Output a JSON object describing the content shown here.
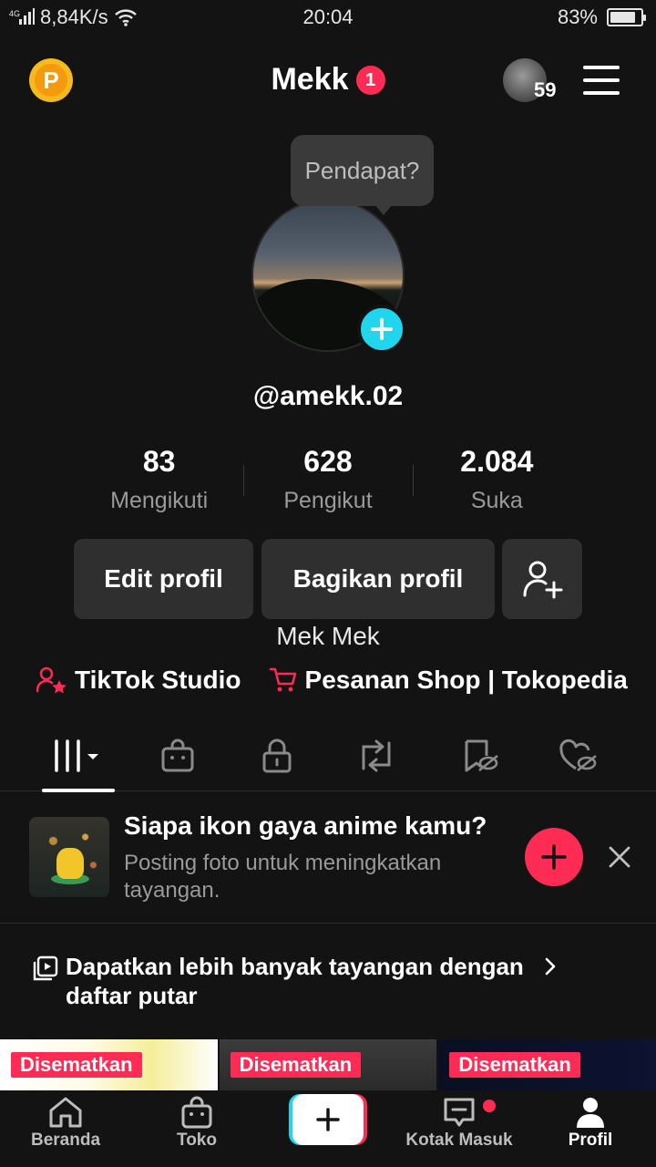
{
  "status_bar": {
    "network": "4G",
    "speed": "8,84K/s",
    "time": "20:04",
    "battery": "83%",
    "battery_level": 0.83
  },
  "header": {
    "title": "Mekk",
    "notification_count": "1",
    "account_count": "59"
  },
  "profile": {
    "tooltip": "Pendapat?",
    "username": "@amekk.02",
    "stats": [
      {
        "value": "83",
        "label": "Mengikuti"
      },
      {
        "value": "628",
        "label": "Pengikut"
      },
      {
        "value": "2.084",
        "label": "Suka"
      }
    ],
    "edit_label": "Edit profil",
    "share_label": "Bagikan profil",
    "bio": "Mek Mek",
    "links": {
      "studio": "TikTok Studio",
      "shop": "Pesanan Shop | Tokopedia"
    }
  },
  "suggestion": {
    "title": "Siapa ikon gaya anime kamu?",
    "subtitle": "Posting foto untuk meningkatkan tayangan."
  },
  "playlist": {
    "text": "Dapatkan lebih banyak tayangan dengan daftar putar"
  },
  "grid": {
    "pinned_label": "Disematkan"
  },
  "nav": {
    "home": "Beranda",
    "shop": "Toko",
    "inbox": "Kotak Masuk",
    "profile": "Profil"
  },
  "colors": {
    "accent": "#fe2c55",
    "cyan": "#20d5ec",
    "background": "#131313",
    "coin": "#f8b91c"
  }
}
